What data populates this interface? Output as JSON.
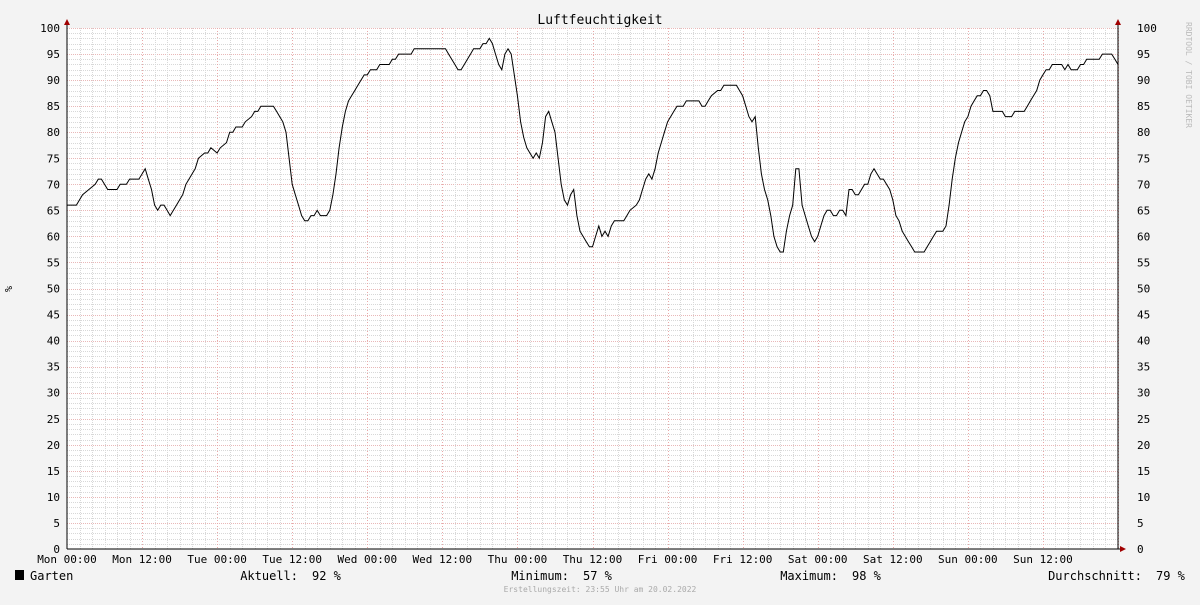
{
  "chart_data": {
    "type": "line",
    "title": "Luftfeuchtigkeit",
    "ylabel": "%",
    "ylabel_right": "%",
    "ylim": [
      0,
      100
    ],
    "y_ticks": [
      "0",
      "5",
      "10",
      "15",
      "20",
      "25",
      "30",
      "35",
      "40",
      "45",
      "50",
      "55",
      "60",
      "65",
      "70",
      "75",
      "80",
      "85",
      "90",
      "95",
      "100"
    ],
    "x_ticks": [
      "Mon 00:00",
      "Mon 12:00",
      "Tue 00:00",
      "Tue 12:00",
      "Wed 00:00",
      "Wed 12:00",
      "Thu 00:00",
      "Thu 12:00",
      "Fri 00:00",
      "Fri 12:00",
      "Sat 00:00",
      "Sat 12:00",
      "Sun 00:00",
      "Sun 12:00"
    ],
    "xlim_hours": [
      0,
      168
    ],
    "grid": true,
    "series": [
      {
        "name": "Garten",
        "color": "#000000",
        "points": [
          [
            0,
            66
          ],
          [
            1.5,
            66
          ],
          [
            2,
            67
          ],
          [
            2.5,
            68
          ],
          [
            3.5,
            69
          ],
          [
            4.5,
            70
          ],
          [
            5,
            71
          ],
          [
            5.5,
            71
          ],
          [
            6,
            70
          ],
          [
            6.5,
            69
          ],
          [
            7.5,
            69
          ],
          [
            8,
            69
          ],
          [
            8.5,
            70
          ],
          [
            9.5,
            70
          ],
          [
            10,
            71
          ],
          [
            11.5,
            71
          ],
          [
            12,
            72
          ],
          [
            12.5,
            73
          ],
          [
            13,
            71
          ],
          [
            13.5,
            69
          ],
          [
            14,
            66
          ],
          [
            14.5,
            65
          ],
          [
            15,
            66
          ],
          [
            15.5,
            66
          ],
          [
            16,
            65
          ],
          [
            16.5,
            64
          ],
          [
            17,
            65
          ],
          [
            17.5,
            66
          ],
          [
            18,
            67
          ],
          [
            18.5,
            68
          ],
          [
            19,
            70
          ],
          [
            19.5,
            71
          ],
          [
            20,
            72
          ],
          [
            20.5,
            73
          ],
          [
            21,
            75
          ],
          [
            22,
            76
          ],
          [
            22.5,
            76
          ],
          [
            23,
            77
          ],
          [
            24,
            76
          ],
          [
            24.5,
            77
          ],
          [
            25.5,
            78
          ],
          [
            26,
            80
          ],
          [
            26.5,
            80
          ],
          [
            27,
            81
          ],
          [
            28,
            81
          ],
          [
            28.5,
            82
          ],
          [
            29.5,
            83
          ],
          [
            30,
            84
          ],
          [
            30.5,
            84
          ],
          [
            31,
            85
          ],
          [
            33,
            85
          ],
          [
            33.5,
            84
          ],
          [
            34,
            83
          ],
          [
            34.5,
            82
          ],
          [
            35,
            80
          ],
          [
            35.5,
            75
          ],
          [
            36,
            70
          ],
          [
            36.5,
            68
          ],
          [
            37,
            66
          ],
          [
            37.5,
            64
          ],
          [
            38,
            63
          ],
          [
            38.5,
            63
          ],
          [
            39,
            64
          ],
          [
            39.5,
            64
          ],
          [
            40,
            65
          ],
          [
            40.5,
            64
          ],
          [
            41,
            64
          ],
          [
            41.5,
            64
          ],
          [
            42,
            65
          ],
          [
            42.5,
            68
          ],
          [
            43,
            72
          ],
          [
            43.5,
            77
          ],
          [
            44,
            81
          ],
          [
            44.5,
            84
          ],
          [
            45,
            86
          ],
          [
            45.5,
            87
          ],
          [
            46,
            88
          ],
          [
            46.5,
            89
          ],
          [
            47,
            90
          ],
          [
            47.5,
            91
          ],
          [
            48,
            91
          ],
          [
            48.5,
            92
          ],
          [
            49,
            92
          ],
          [
            49.5,
            92
          ],
          [
            50,
            93
          ],
          [
            51,
            93
          ],
          [
            51.5,
            93
          ],
          [
            52,
            94
          ],
          [
            52.5,
            94
          ],
          [
            53,
            95
          ],
          [
            55,
            95
          ],
          [
            55.5,
            96
          ],
          [
            60,
            96
          ],
          [
            60.5,
            96
          ],
          [
            61,
            95
          ],
          [
            61.5,
            94
          ],
          [
            62,
            93
          ],
          [
            62.5,
            92
          ],
          [
            63,
            92
          ],
          [
            63.5,
            93
          ],
          [
            64,
            94
          ],
          [
            64.5,
            95
          ],
          [
            65,
            96
          ],
          [
            66,
            96
          ],
          [
            66.5,
            97
          ],
          [
            67,
            97
          ],
          [
            67.5,
            98
          ],
          [
            68,
            97
          ],
          [
            68.5,
            95
          ],
          [
            69,
            93
          ],
          [
            69.5,
            92
          ],
          [
            70,
            95
          ],
          [
            70.5,
            96
          ],
          [
            71,
            95
          ],
          [
            71.5,
            91
          ],
          [
            72,
            87
          ],
          [
            72.5,
            82
          ],
          [
            73,
            79
          ],
          [
            73.5,
            77
          ],
          [
            74,
            76
          ],
          [
            74.5,
            75
          ],
          [
            75,
            76
          ],
          [
            75.5,
            75
          ],
          [
            76,
            78
          ],
          [
            76.5,
            83
          ],
          [
            77,
            84
          ],
          [
            77.5,
            82
          ],
          [
            78,
            80
          ],
          [
            78.5,
            75
          ],
          [
            79,
            70
          ],
          [
            79.5,
            67
          ],
          [
            80,
            66
          ],
          [
            80.5,
            68
          ],
          [
            81,
            69
          ],
          [
            81.5,
            64
          ],
          [
            82,
            61
          ],
          [
            82.5,
            60
          ],
          [
            83,
            59
          ],
          [
            83.5,
            58
          ],
          [
            84,
            58
          ],
          [
            84.5,
            60
          ],
          [
            85,
            62
          ],
          [
            85.5,
            60
          ],
          [
            86,
            61
          ],
          [
            86.5,
            60
          ],
          [
            87,
            62
          ],
          [
            87.5,
            63
          ],
          [
            89,
            63
          ],
          [
            89.5,
            64
          ],
          [
            90,
            65
          ],
          [
            91,
            66
          ],
          [
            91.5,
            67
          ],
          [
            92,
            69
          ],
          [
            92.5,
            71
          ],
          [
            93,
            72
          ],
          [
            93.5,
            71
          ],
          [
            94,
            73
          ],
          [
            94.5,
            76
          ],
          [
            95,
            78
          ],
          [
            95.5,
            80
          ],
          [
            96,
            82
          ],
          [
            96.5,
            83
          ],
          [
            97,
            84
          ],
          [
            97.5,
            85
          ],
          [
            98.5,
            85
          ],
          [
            99,
            86
          ],
          [
            101,
            86
          ],
          [
            101.5,
            85
          ],
          [
            102,
            85
          ],
          [
            102.5,
            86
          ],
          [
            103,
            87
          ],
          [
            104,
            88
          ],
          [
            104.5,
            88
          ],
          [
            105,
            89
          ],
          [
            107,
            89
          ],
          [
            107.5,
            88
          ],
          [
            108,
            87
          ],
          [
            108.5,
            85
          ],
          [
            109,
            83
          ],
          [
            109.5,
            82
          ],
          [
            110,
            83
          ],
          [
            110.5,
            77
          ],
          [
            111,
            72
          ],
          [
            111.5,
            69
          ],
          [
            112,
            67
          ],
          [
            112.5,
            64
          ],
          [
            113,
            60
          ],
          [
            113.5,
            58
          ],
          [
            114,
            57
          ],
          [
            114.5,
            57
          ],
          [
            115,
            61
          ],
          [
            115.5,
            64
          ],
          [
            116,
            66
          ],
          [
            116.5,
            73
          ],
          [
            117,
            73
          ],
          [
            117.5,
            66
          ],
          [
            118,
            64
          ],
          [
            118.5,
            62
          ],
          [
            119,
            60
          ],
          [
            119.5,
            59
          ],
          [
            120,
            60
          ],
          [
            120.5,
            62
          ],
          [
            121,
            64
          ],
          [
            121.5,
            65
          ],
          [
            122,
            65
          ],
          [
            122.5,
            64
          ],
          [
            123,
            64
          ],
          [
            123.5,
            65
          ],
          [
            124,
            65
          ],
          [
            124.5,
            64
          ],
          [
            125,
            69
          ],
          [
            125.5,
            69
          ],
          [
            126,
            68
          ],
          [
            126.5,
            68
          ],
          [
            127,
            69
          ],
          [
            127.5,
            70
          ],
          [
            128,
            70
          ],
          [
            128.5,
            72
          ],
          [
            129,
            73
          ],
          [
            129.5,
            72
          ],
          [
            130,
            71
          ],
          [
            130.5,
            71
          ],
          [
            131,
            70
          ],
          [
            131.5,
            69
          ],
          [
            132,
            67
          ],
          [
            132.5,
            64
          ],
          [
            133,
            63
          ],
          [
            133.5,
            61
          ],
          [
            134,
            60
          ],
          [
            134.5,
            59
          ],
          [
            135,
            58
          ],
          [
            135.5,
            57
          ],
          [
            136,
            57
          ],
          [
            137,
            57
          ],
          [
            137.5,
            58
          ],
          [
            138,
            59
          ],
          [
            138.5,
            60
          ],
          [
            139,
            61
          ],
          [
            140,
            61
          ],
          [
            140.5,
            62
          ],
          [
            141,
            66
          ],
          [
            141.5,
            71
          ],
          [
            142,
            75
          ],
          [
            142.5,
            78
          ],
          [
            143,
            80
          ],
          [
            143.5,
            82
          ],
          [
            144,
            83
          ],
          [
            144.5,
            85
          ],
          [
            145,
            86
          ],
          [
            145.5,
            87
          ],
          [
            146,
            87
          ],
          [
            146.5,
            88
          ],
          [
            147,
            88
          ],
          [
            147.5,
            87
          ],
          [
            148,
            84
          ],
          [
            149.5,
            84
          ],
          [
            150,
            83
          ],
          [
            150.5,
            83
          ],
          [
            151,
            83
          ],
          [
            151.5,
            84
          ],
          [
            153,
            84
          ],
          [
            153.5,
            85
          ],
          [
            154,
            86
          ],
          [
            154.5,
            87
          ],
          [
            155,
            88
          ],
          [
            155.5,
            90
          ],
          [
            156,
            91
          ],
          [
            156.5,
            92
          ],
          [
            157,
            92
          ],
          [
            157.5,
            93
          ],
          [
            159,
            93
          ],
          [
            159.5,
            92
          ],
          [
            160,
            93
          ],
          [
            160.5,
            92
          ],
          [
            161.5,
            92
          ],
          [
            162,
            93
          ],
          [
            162.5,
            93
          ],
          [
            163,
            94
          ],
          [
            165,
            94
          ],
          [
            165.5,
            95
          ],
          [
            167,
            95
          ],
          [
            167.5,
            94
          ],
          [
            168,
            93
          ],
          [
            168.5,
            92
          ],
          [
            169,
            92
          ]
        ]
      }
    ]
  },
  "legend": {
    "series_label": "Garten",
    "color": "#000000",
    "current_label": "Aktuell:",
    "current_value": "92 %",
    "min_label": "Minimum:",
    "min_value": "57 %",
    "max_label": "Maximum:",
    "max_value": "98 %",
    "avg_label": "Durchschnitt:",
    "avg_value": "79 %"
  },
  "watermark": "RRDTOOL / TOBI OETIKER",
  "footer": "Erstellungszeit: 23:55 Uhr am 20.02.2022"
}
